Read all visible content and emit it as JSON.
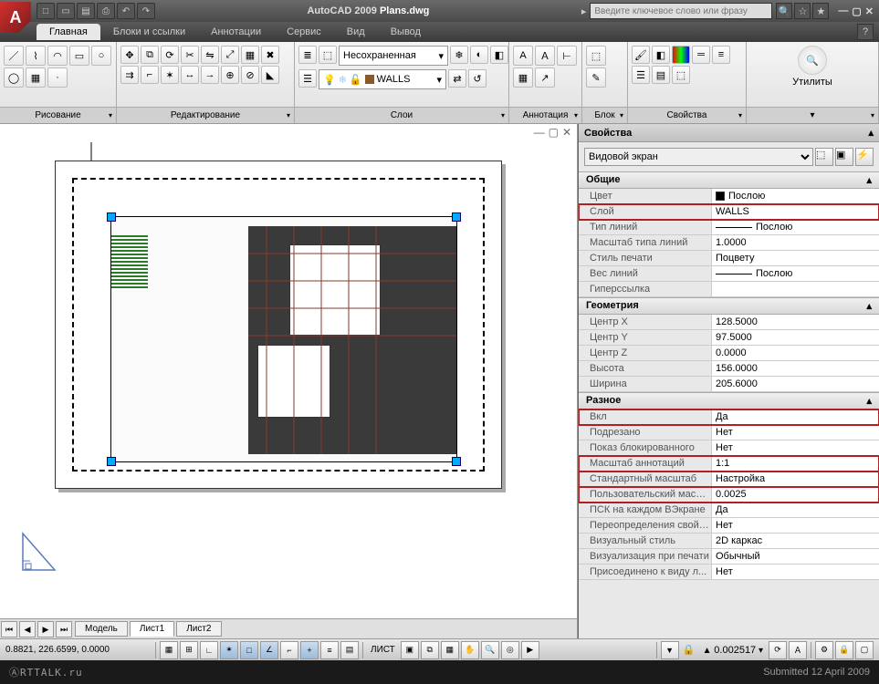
{
  "app": {
    "title_prefix": "AutoCAD 2009",
    "filename": "Plans.dwg",
    "search_placeholder": "Введите ключевое слово или фразу"
  },
  "menu": {
    "tabs": [
      "Главная",
      "Блоки и ссылки",
      "Аннотации",
      "Сервис",
      "Вид",
      "Вывод"
    ],
    "active": 0
  },
  "ribbon": {
    "panels": {
      "draw": "Рисование",
      "edit": "Редактирование",
      "layers": "Слои",
      "annotation": "Аннотация",
      "block": "Блок",
      "properties": "Свойства",
      "utilities": "Утилиты"
    },
    "layer_state": "Несохраненная",
    "current_layer": "WALLS"
  },
  "properties": {
    "title": "Свойства",
    "object_type": "Видовой экран",
    "sections": {
      "general": "Общие",
      "geometry": "Геометрия",
      "misc": "Разное"
    },
    "general": [
      {
        "label": "Цвет",
        "value": "Послою",
        "swatch": "#000",
        "hl": false
      },
      {
        "label": "Слой",
        "value": "WALLS",
        "hl": true
      },
      {
        "label": "Тип линий",
        "value": "Послою",
        "line": true,
        "hl": false
      },
      {
        "label": "Масштаб типа линий",
        "value": "1.0000",
        "hl": false
      },
      {
        "label": "Стиль печати",
        "value": "Поцвету",
        "hl": false
      },
      {
        "label": "Вес линий",
        "value": "Послою",
        "line": true,
        "hl": false
      },
      {
        "label": "Гиперссылка",
        "value": "",
        "hl": false
      }
    ],
    "geometry": [
      {
        "label": "Центр X",
        "value": "128.5000"
      },
      {
        "label": "Центр Y",
        "value": "97.5000"
      },
      {
        "label": "Центр Z",
        "value": "0.0000"
      },
      {
        "label": "Высота",
        "value": "156.0000"
      },
      {
        "label": "Ширина",
        "value": "205.6000"
      }
    ],
    "misc": [
      {
        "label": "Вкл",
        "value": "Да",
        "hl": true
      },
      {
        "label": "Подрезано",
        "value": "Нет",
        "hl": false
      },
      {
        "label": "Показ блокированного",
        "value": "Нет",
        "hl": false
      },
      {
        "label": "Масштаб аннотаций",
        "value": "1:1",
        "hl": true
      },
      {
        "label": "Стандартный масштаб",
        "value": "Настройка",
        "hl": true
      },
      {
        "label": "Пользовательский масш...",
        "value": "0.0025",
        "hl": true
      },
      {
        "label": "ПСК на каждом ВЭкране",
        "value": "Да",
        "hl": false
      },
      {
        "label": "Переопределения свойс...",
        "value": "Нет",
        "hl": false
      },
      {
        "label": "Визуальный стиль",
        "value": "2D каркас",
        "hl": false
      },
      {
        "label": "Визуализация при печати",
        "value": "Обычный",
        "hl": false
      },
      {
        "label": "Присоединено к виду л...",
        "value": "Нет",
        "hl": false
      }
    ]
  },
  "layout_tabs": {
    "items": [
      "Модель",
      "Лист1",
      "Лист2"
    ],
    "active": 1
  },
  "status": {
    "coords": "0.8821, 226.6599, 0.0000",
    "space": "ЛИСТ",
    "scale": "0.002517"
  },
  "footer": {
    "site": "ⒶRTTALK.ru",
    "submitted": "Submitted 12 April 2009"
  }
}
